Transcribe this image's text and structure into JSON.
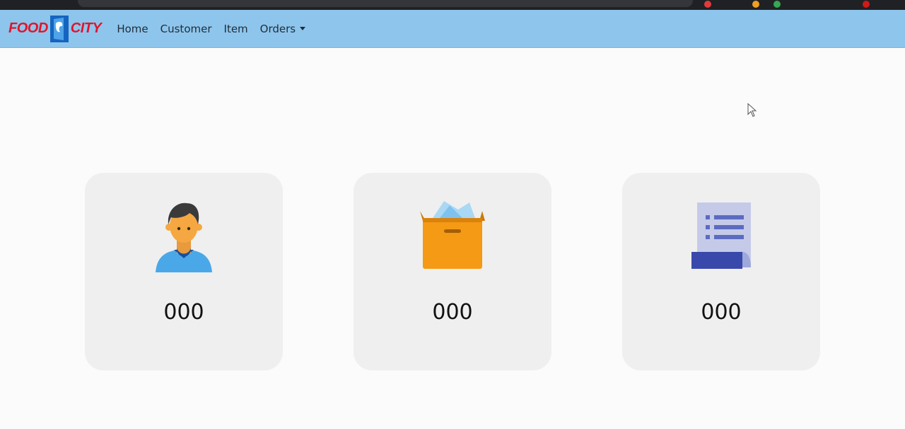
{
  "brand": {
    "left_text": "FOOD",
    "right_text": "CITY"
  },
  "nav": {
    "home": "Home",
    "customer": "Customer",
    "item": "Item",
    "orders": "Orders"
  },
  "cards": {
    "customer": {
      "icon": "user-icon",
      "count": "000"
    },
    "item": {
      "icon": "box-icon",
      "count": "000"
    },
    "orders": {
      "icon": "receipt-icon",
      "count": "000"
    }
  },
  "colors": {
    "navbar": "#8ec5ec",
    "brand_red": "#e0152b",
    "brand_blue": "#1565c0",
    "card_bg": "#efefef"
  }
}
